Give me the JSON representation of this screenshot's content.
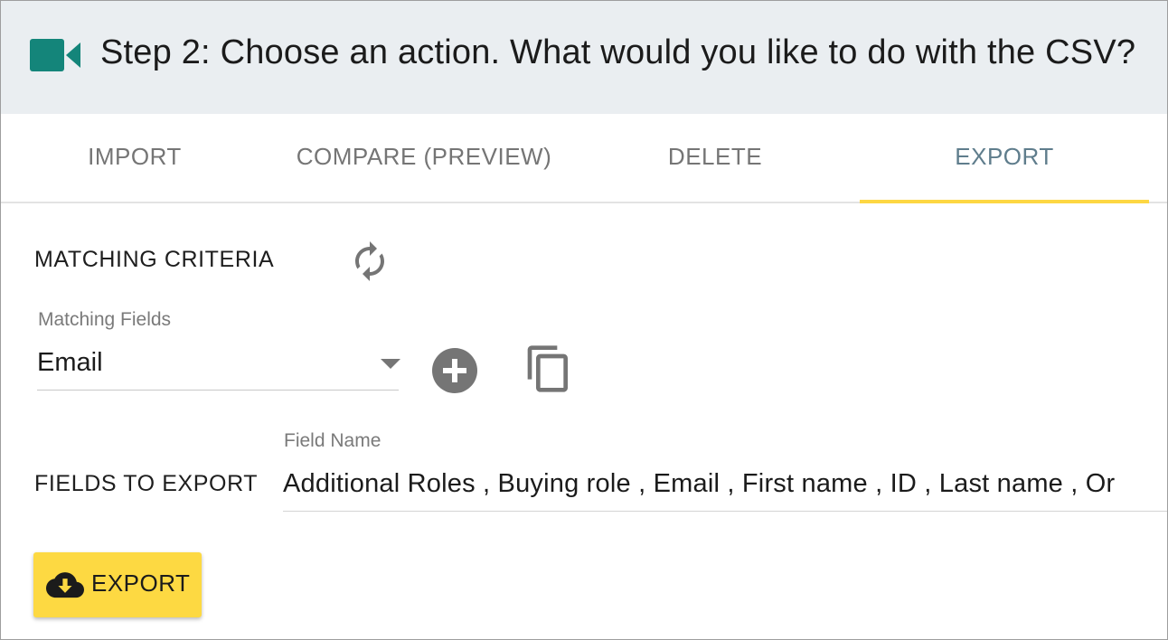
{
  "header": {
    "title": "Step 2: Choose an action. What would you like to do with the CSV?",
    "icon": "video-camera-icon",
    "icon_color": "#14857a"
  },
  "tabs": [
    {
      "label": "IMPORT",
      "active": false
    },
    {
      "label": "COMPARE (PREVIEW)",
      "active": false
    },
    {
      "label": "DELETE",
      "active": false
    },
    {
      "label": "EXPORT",
      "active": true
    }
  ],
  "matching": {
    "section_label": "MATCHING CRITERIA",
    "field_caption": "Matching Fields",
    "selected_value": "Email"
  },
  "fields_to_export": {
    "section_label": "FIELDS TO EXPORT",
    "field_caption": "Field Name",
    "value": "Additional Roles , Buying role , Email , First name , ID , Last name , Or"
  },
  "export_button": {
    "label": "EXPORT",
    "icon": "cloud-download-icon",
    "color": "#fdd942"
  },
  "colors": {
    "accent_underline": "#fdd743",
    "active_tab_text": "#5f7d8c",
    "inactive_tab_text": "#757575",
    "header_bg": "#eaeef1",
    "icon_gray": "#757575"
  }
}
